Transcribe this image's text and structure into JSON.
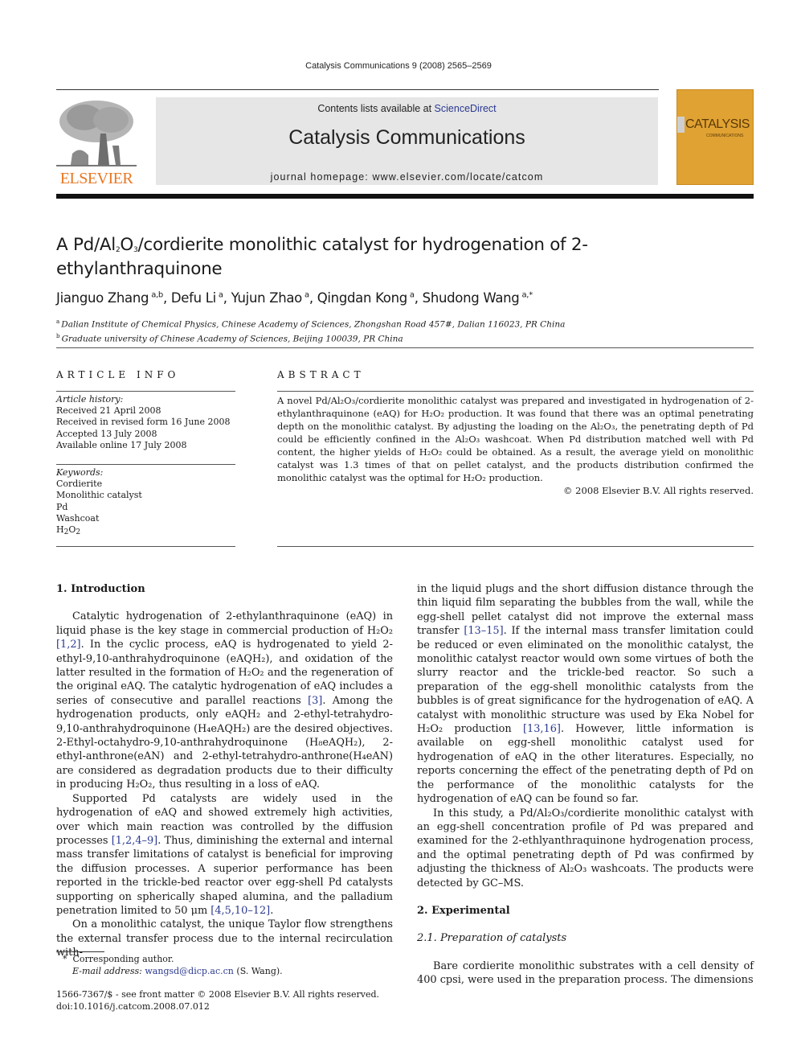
{
  "header": {
    "journal_ref": "Catalysis Communications 9 (2008) 2565–2569",
    "contents_prefix": "Contents lists available at ",
    "contents_link": "ScienceDirect",
    "journal_title": "Catalysis Communications",
    "homepage": "journal homepage: www.elsevier.com/locate/catcom",
    "publisher_logo_text": "ELSEVIER",
    "cover_title": "CATALYSIS",
    "cover_subtitle": "COMMUNICATIONS",
    "colors": {
      "elsevier_orange": "#e87722",
      "cover_gold": "#e0a232",
      "link_blue": "#2b3990",
      "banner_gray": "#e6e6e6"
    }
  },
  "article": {
    "title_parts": [
      "A Pd/Al",
      "2",
      "O",
      "3",
      "/cordierite monolithic catalyst for hydrogenation of 2-ethylanthraquinone"
    ],
    "authors": [
      {
        "name": "Jianguo Zhang",
        "sup": "a,b"
      },
      {
        "name": "Defu Li",
        "sup": "a"
      },
      {
        "name": "Yujun Zhao",
        "sup": "a"
      },
      {
        "name": "Qingdan Kong",
        "sup": "a"
      },
      {
        "name": "Shudong Wang",
        "sup": "a,*"
      }
    ],
    "affiliations": [
      {
        "mark": "a",
        "text": "Dalian Institute of Chemical Physics, Chinese Academy of Sciences, Zhongshan Road 457#, Dalian 116023, PR China"
      },
      {
        "mark": "b",
        "text": "Graduate university of Chinese Academy of Sciences, Beijing 100039, PR China"
      }
    ]
  },
  "article_info": {
    "heading": "ARTICLE INFO",
    "history_label": "Article history:",
    "history": [
      "Received 21 April 2008",
      "Received in revised form 16 June 2008",
      "Accepted 13 July 2008",
      "Available online 17 July 2008"
    ],
    "keywords_label": "Keywords:",
    "keywords": [
      "Cordierite",
      "Monolithic catalyst",
      "Pd",
      "Washcoat",
      "H2O2"
    ]
  },
  "abstract": {
    "heading": "ABSTRACT",
    "text": "A novel Pd/Al₂O₃/cordierite monolithic catalyst was prepared and investigated in hydrogenation of 2-ethylanthraquinone (eAQ) for H₂O₂ production. It was found that there was an optimal penetrating depth on the monolithic catalyst. By adjusting the loading on the Al₂O₃, the penetrating depth of Pd could be efficiently confined in the Al₂O₃ washcoat. When Pd distribution matched well with Pd content, the higher yields of H₂O₂ could be obtained. As a result, the average yield on monolithic catalyst was 1.3 times of that on pellet catalyst, and the products distribution confirmed the monolithic catalyst was the optimal for H₂O₂ production.",
    "copyright": "© 2008 Elsevier B.V. All rights reserved."
  },
  "body": {
    "sec1_heading": "1. Introduction",
    "sec1_p1": "Catalytic hydrogenation of 2-ethylanthraquinone (eAQ) in liquid phase is the key stage in commercial production of H₂O₂ [1,2]. In the cyclic process, eAQ is hydrogenated to yield 2-ethyl-9,10-anthrahydroquinone (eAQH₂), and oxidation of the latter resulted in the formation of H₂O₂ and the regeneration of the original eAQ. The catalytic hydrogenation of eAQ includes a series of consecutive and parallel reactions [3]. Among the hydrogenation products, only eAQH₂ and 2-ethyl-tetrahydro-9,10-anthrahydroquinone (H₄eAQH₂) are the desired objectives. 2-Ethyl-octahydro-9,10-anthrahydroquinone (H₈eAQH₂), 2-ethyl-anthrone(eAN) and 2-ethyl-tetrahydro-anthrone(H₄eAN) are considered as degradation products due to their difficulty in producing H₂O₂, thus resulting in a loss of eAQ.",
    "sec1_p2": "Supported Pd catalysts are widely used in the hydrogenation of eAQ and showed extremely high activities, over which main reaction was controlled by the diffusion processes [1,2,4–9]. Thus, diminishing the external and internal mass transfer limitations of catalyst is beneficial for improving the diffusion processes. A superior performance has been reported in the trickle-bed reactor over egg-shell Pd catalysts supporting on spherically shaped alumina, and the palladium penetration limited to 50 μm [4,5,10–12].",
    "sec1_p3": "On a monolithic catalyst, the unique Taylor flow strengthens the external transfer process due to the internal recirculation within the liquid plugs and the short diffusion distance through the thin liquid film separating the bubbles from the wall, while the egg-shell pellet catalyst did not improve the external mass transfer [13–15]. If the internal mass transfer limitation could be reduced or even eliminated on the monolithic catalyst, the monolithic catalyst reactor would own some virtues of both the slurry reactor and the trickle-bed reactor. So such a preparation of the egg-shell monolithic catalysts from the bubbles is of great significance for the hydrogenation of eAQ. A catalyst with monolithic structure was used by Eka Nobel for H₂O₂ production [13,16]. However, little information is available on egg-shell monolithic catalyst used for hydrogenation of eAQ in the other literatures. Especially, no reports concerning the effect of the penetrating depth of Pd on the performance of the monolithic catalysts for the hydrogenation of eAQ can be found so far.",
    "sec1_p3_left": "On a monolithic catalyst, the unique Taylor flow strengthens the external transfer process due to the internal recirculation with-",
    "sec1_p3_right": "in the liquid plugs and the short diffusion distance through the thin liquid film separating the bubbles from the wall, while the egg-shell pellet catalyst did not improve the external mass transfer [13–15]. If the internal mass transfer limitation could be reduced or even eliminated on the monolithic catalyst, the monolithic catalyst reactor would own some virtues of both the slurry reactor and the trickle-bed reactor. So such a preparation of the egg-shell monolithic catalysts from the bubbles is of great significance for the hydrogenation of eAQ. A catalyst with monolithic structure was used by Eka Nobel for H₂O₂ production [13,16]. However, little information is available on egg-shell monolithic catalyst used for hydrogenation of eAQ in the other literatures. Especially, no reports concerning the effect of the penetrating depth of Pd on the performance of the monolithic catalysts for the hydrogenation of eAQ can be found so far.",
    "sec1_p4": "In this study, a Pd/Al₂O₃/cordierite monolithic catalyst with an egg-shell concentration profile of Pd was prepared and examined for the 2-ethlyanthraquinone hydrogenation process, and the optimal penetrating depth of Pd was confirmed by adjusting the thickness of Al₂O₃ washcoats. The products were detected by GC–MS.",
    "sec2_heading": "2. Experimental",
    "sec21_heading": "2.1. Preparation of catalysts",
    "sec21_p1": "Bare cordierite monolithic substrates with a cell density of 400 cpsi, were used in the preparation process. The dimensions"
  },
  "footnotes": {
    "corresponding_mark": "*",
    "corresponding": "Corresponding author.",
    "email_label": "E-mail address:",
    "email": "wangsd@dicp.ac.cn",
    "email_owner": "(S. Wang).",
    "issn_line": "1566-7367/$ - see front matter © 2008 Elsevier B.V. All rights reserved.",
    "doi": "doi:10.1016/j.catcom.2008.07.012"
  }
}
